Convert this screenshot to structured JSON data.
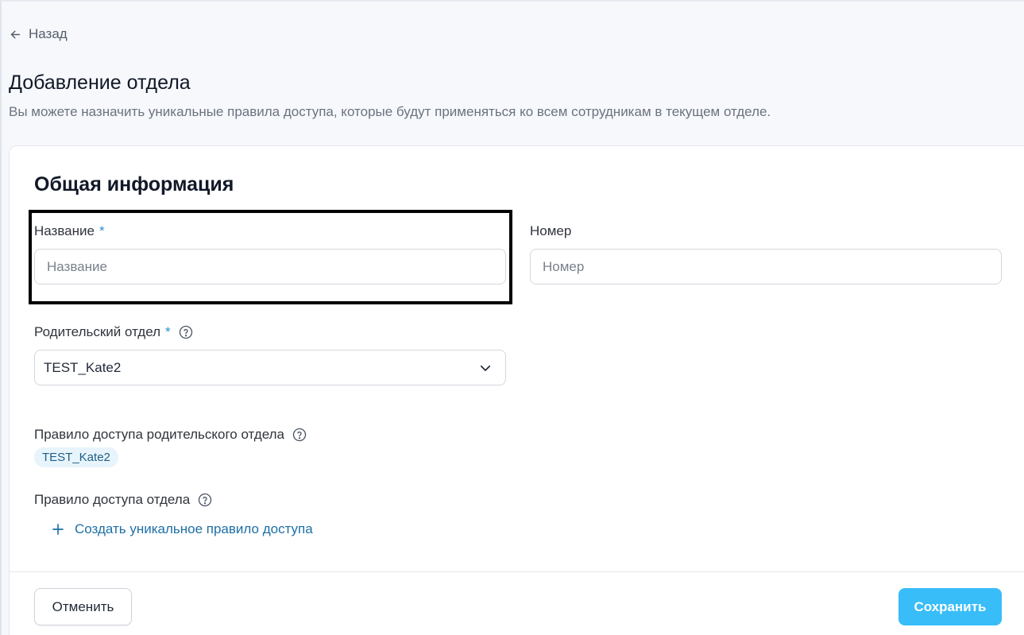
{
  "nav": {
    "back_label": "Назад"
  },
  "page": {
    "title": "Добавление отдела",
    "description": "Вы можете назначить уникальные правила доступа, которые будут применяться ко всем сотрудникам в текущем отделе."
  },
  "form": {
    "section_title": "Общая информация",
    "name": {
      "label": "Название",
      "required_mark": "*",
      "placeholder": "Название",
      "value": ""
    },
    "number": {
      "label": "Номер",
      "placeholder": "Номер",
      "value": ""
    },
    "parent": {
      "label": "Родительский отдел",
      "required_mark": "*",
      "selected": "TEST_Kate2"
    },
    "parent_access_rule": {
      "label": "Правило доступа родительского отдела",
      "tag": "TEST_Kate2"
    },
    "access_rule": {
      "label": "Правило доступа отдела",
      "create_link": "Создать уникальное правило доступа"
    }
  },
  "actions": {
    "cancel_label": "Отменить",
    "save_label": "Сохранить"
  },
  "colors": {
    "accent": "#38bdf8",
    "link": "#1d6fa6",
    "required": "#2b8fd6",
    "highlight_border": "#000000"
  },
  "icons": [
    "arrow-left-icon",
    "help-circle-icon",
    "chevron-down-icon",
    "plus-icon"
  ]
}
